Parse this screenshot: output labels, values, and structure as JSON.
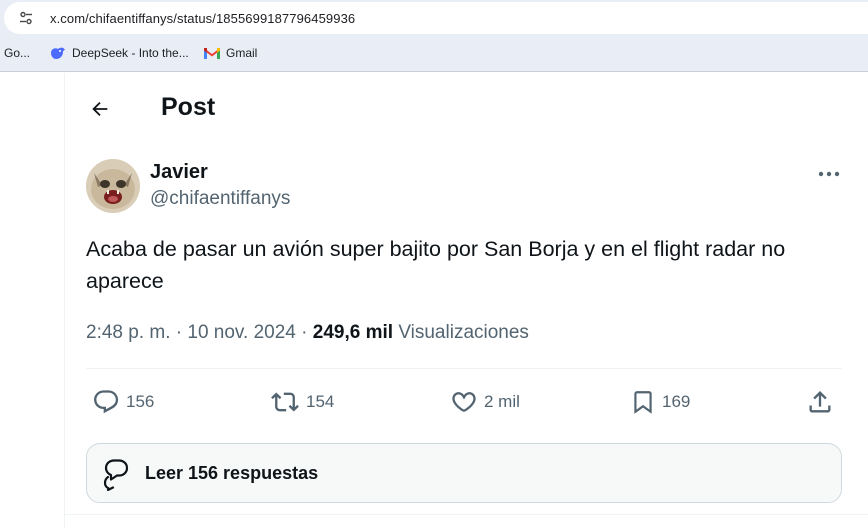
{
  "browser": {
    "url": "x.com/chifaentiffanys/status/1855699187796459936",
    "bookmarks": [
      {
        "label": "Go...",
        "icon": "google-icon"
      },
      {
        "label": "DeepSeek - Into the...",
        "icon": "deepseek-icon"
      },
      {
        "label": "Gmail",
        "icon": "gmail-icon"
      }
    ]
  },
  "header": {
    "title": "Post"
  },
  "post": {
    "author_name": "Javier",
    "author_handle": "@chifaentiffanys",
    "text": "Acaba de pasar un avión super bajito por San Borja y en el flight radar no aparece",
    "time": "2:48 p. m.",
    "date": "10 nov. 2024",
    "separator": "·",
    "views_count": "249,6 mil",
    "views_label": "Visualizaciones"
  },
  "actions": {
    "replies": "156",
    "reposts": "154",
    "likes": "2 mil",
    "bookmarks": "169"
  },
  "read_replies_label": "Leer 156 respuestas",
  "colors": {
    "text_primary": "#0f1419",
    "text_secondary": "#536471",
    "border": "#eff3f4",
    "chrome_bg": "#e9eef6"
  }
}
